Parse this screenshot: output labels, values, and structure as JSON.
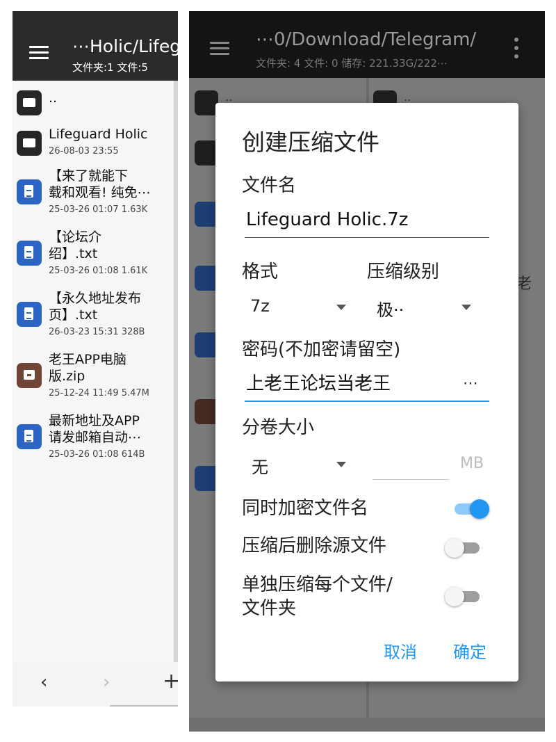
{
  "left_pane": {
    "title": "⋯Holic/Lifeg",
    "subtitle": "文件夹:1  文件:5",
    "parent_dir": "..",
    "items": [
      {
        "icon": "folder-icon",
        "name_lines": [
          "Lifeguard Holic"
        ],
        "meta": "26-08-03 23:55"
      },
      {
        "icon": "text-file-icon",
        "name_lines": [
          "【来了就能下",
          "载和观看! 纯免⋯"
        ],
        "meta": "25-03-26 01:07  1.63K"
      },
      {
        "icon": "text-file-icon",
        "name_lines": [
          "【论坛介",
          "绍】.txt"
        ],
        "meta": "25-03-26 01:08  1.61K"
      },
      {
        "icon": "text-file-icon",
        "name_lines": [
          "【永久地址发布",
          "页】.txt"
        ],
        "meta": "26-03-23 15:31  328B"
      },
      {
        "icon": "archive-icon",
        "name_lines": [
          "老王APP电脑",
          "版.zip"
        ],
        "meta": "25-12-24 11:49  5.47M"
      },
      {
        "icon": "text-file-icon",
        "name_lines": [
          "最新地址及APP",
          "请发邮箱自动⋯"
        ],
        "meta": "25-03-26 01:08  614B"
      }
    ],
    "nav": {
      "back": "‹",
      "forward": "›",
      "add": "+"
    }
  },
  "right_pane": {
    "title": "⋯0/Download/Telegram/",
    "subtitle": "文件夹: 4  文件: 0  储存: 221.33G/222⋯",
    "parent_dir": "..",
    "peek_text": "老"
  },
  "dialog": {
    "title": "创建压缩文件",
    "filename_label": "文件名",
    "filename_value": "Lifeguard Holic.7z",
    "format_label": "格式",
    "format_value": "7z",
    "level_label": "压缩级别",
    "level_value": "极··",
    "password_label": "密码(不加密请留空)",
    "password_value": "上老王论坛当老王",
    "password_overflow": "⋯",
    "volume_label": "分卷大小",
    "volume_value": "无",
    "volume_unit": "MB",
    "switches": [
      {
        "label_lines": [
          "同时加密文件名"
        ],
        "on": true
      },
      {
        "label_lines": [
          "压缩后删除源文件"
        ],
        "on": false
      },
      {
        "label_lines": [
          "单独压缩每个文件/",
          "文件夹"
        ],
        "on": false
      }
    ],
    "cancel_label": "取消",
    "ok_label": "确定"
  },
  "colors": {
    "accent": "#2196f3",
    "doc_icon": "#2b64c3",
    "folder_icon": "#262626",
    "archive_icon": "#6f4536",
    "header_dark": "#2b2b2b"
  }
}
